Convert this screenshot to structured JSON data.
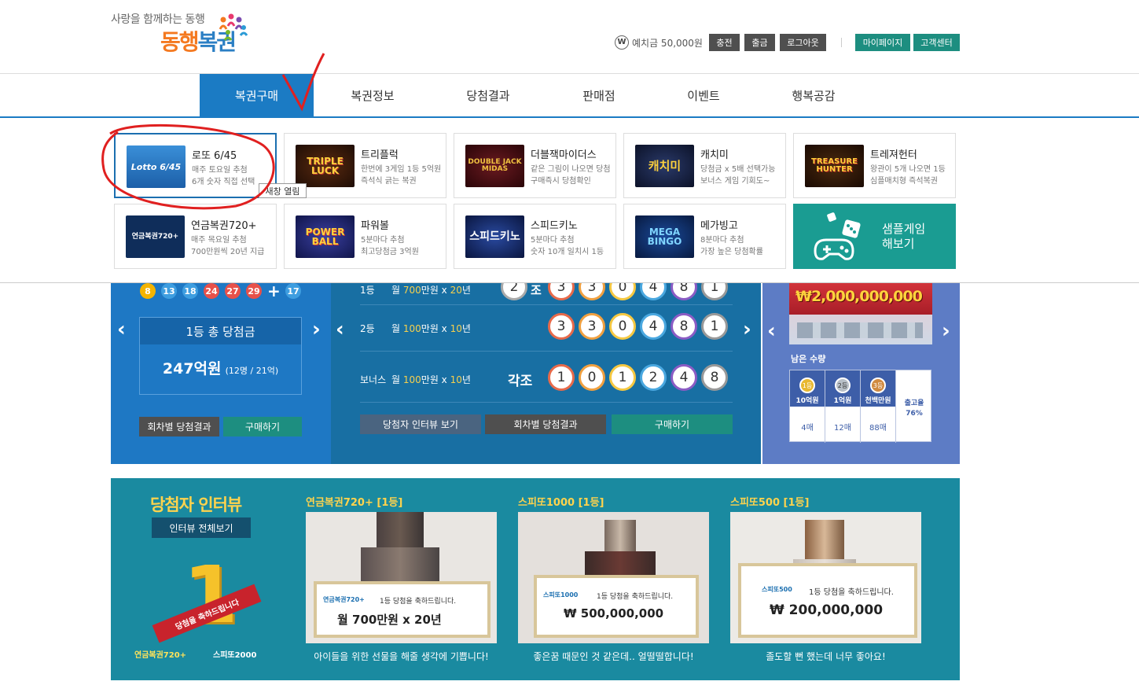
{
  "header": {
    "tagline": "사랑을 함께하는 동행",
    "logo_part1": "동행",
    "logo_part2": "복권",
    "currency_icon": "W",
    "deposit_label": "예치금 50,000원",
    "charge": "충전",
    "withdraw": "출금",
    "logout": "로그아웃",
    "mypage": "마이페이지",
    "support": "고객센터"
  },
  "nav": [
    {
      "label": "복권구매"
    },
    {
      "label": "복권정보"
    },
    {
      "label": "당첨결과"
    },
    {
      "label": "판매점"
    },
    {
      "label": "이벤트"
    },
    {
      "label": "행복공감"
    }
  ],
  "games": [
    {
      "title": "로또 6/45",
      "desc1": "매주 토요일 추첨",
      "desc2": "6개 숫자 직접 선택",
      "thumb": "Lotto 6/45"
    },
    {
      "title": "트리플럭",
      "desc1": "한번에 3게임 1등 5억원",
      "desc2": "즉석식 긁는 복권",
      "thumb": "TRIPLE LUCK"
    },
    {
      "title": "더블잭마이더스",
      "desc1": "같은 그림이 나오면 당첨",
      "desc2": "구매즉시 당첨확인",
      "thumb": "DOUBLE JACK MIDAS"
    },
    {
      "title": "캐치미",
      "desc1": "당첨금 x 5배 선택가능",
      "desc2": "보너스 게임 기회도~",
      "thumb": "캐치미"
    },
    {
      "title": "트레져헌터",
      "desc1": "왕관이 5개 나오면 1등",
      "desc2": "심플매치형 즉석복권",
      "thumb": "TREASURE HUNTER"
    },
    {
      "title": "연금복권720+",
      "desc1": "매주 목요일 추첨",
      "desc2": "700만원씩 20년 지급",
      "thumb": "연금복권720+"
    },
    {
      "title": "파워볼",
      "desc1": "5분마다 추첨",
      "desc2": "최고당첨금 3억원",
      "thumb": "POWER BALL"
    },
    {
      "title": "스피드키노",
      "desc1": "5분마다 추첨",
      "desc2": "숫자 10개 일치시 1등",
      "thumb": "스피드키노"
    },
    {
      "title": "메가빙고",
      "desc1": "8분마다 추첨",
      "desc2": "가장 높은 당첨확률",
      "thumb": "MEGA BINGO"
    }
  ],
  "sample_game": {
    "line1": "샘플게임",
    "line2": "해보기"
  },
  "tooltip": "새창 열림",
  "lotto_panel": {
    "balls": [
      "8",
      "13",
      "18",
      "24",
      "27",
      "29"
    ],
    "plus": "+",
    "bonus": "17",
    "prize_title": "1등 총 당첨금",
    "prize_amount": "247억원",
    "prize_detail": "(12명 / 21억)",
    "btn_results": "회차별 당첨결과",
    "btn_buy": "구매하기"
  },
  "pension_panel": {
    "row1_rank": "1등",
    "row1_prize_a": "월",
    "row1_prize_b": "700",
    "row1_prize_c": "만원 x",
    "row1_prize_d": "20",
    "row1_prize_e": "년",
    "row1_group": "2",
    "row1_jo": "조",
    "row1_digits": [
      "3",
      "3",
      "0",
      "4",
      "8",
      "1"
    ],
    "row2_rank": "2등",
    "row2_prize_a": "월",
    "row2_prize_b": "100",
    "row2_prize_c": "만원 x",
    "row2_prize_d": "10",
    "row2_prize_e": "년",
    "row2_digits": [
      "3",
      "3",
      "0",
      "4",
      "8",
      "1"
    ],
    "row3_rank": "보너스",
    "row3_prize_a": "월",
    "row3_prize_b": "100",
    "row3_prize_c": "만원 x",
    "row3_prize_d": "10",
    "row3_prize_e": "년",
    "row3_group": "각조",
    "row3_digits": [
      "1",
      "0",
      "1",
      "2",
      "4",
      "8"
    ],
    "btn_interview": "당첨자 인터뷰 보기",
    "btn_results": "회차별 당첨결과",
    "btn_buy": "구매하기"
  },
  "speetto_panel": {
    "banner": "₩2,000,000,000",
    "remaining": "남은 수량",
    "medals": [
      "1등",
      "2등",
      "3등"
    ],
    "cols": [
      "10억원",
      "1억원",
      "천백만원"
    ],
    "counts": [
      "4매",
      "12매",
      "88매"
    ],
    "release_label": "출고율",
    "release_rate": "76%"
  },
  "interview": {
    "title": "당첨자 인터뷰",
    "view_all": "인터뷰 전체보기",
    "promo_big": "1",
    "promo_ribbon": "당첨을 축하드립니다",
    "promo_logo1": "연금복권720+",
    "promo_logo2": "스피또2000",
    "cards": [
      {
        "title": "연금복권720+ [1등]",
        "board_logo": "연금복권720+",
        "board_msg": "1등 당첨을 축하드립니다.",
        "board_amount": "월 700만원 x 20년",
        "caption": "아이들을 위한 선물을 해줄 생각에 기쁩니다!"
      },
      {
        "title": "스피또1000 [1등]",
        "board_logo": "스피또1000",
        "board_msg": "1등 당첨을 축하드립니다.",
        "board_amount": "₩ 500,000,000",
        "caption": "좋은꿈 때문인 것 같은데.. 얼떨떨합니다!"
      },
      {
        "title": "스피또500 [1등]",
        "board_logo": "스피또500",
        "board_msg": "1등 당첨을 축하드립니다.",
        "board_amount": "₩ 200,000,000",
        "caption": "졸도할 뻔 했는데 너무 좋아요!"
      }
    ]
  },
  "colors": {
    "primary": "#1b7bc4",
    "teal": "#1d8e80",
    "dark_btn": "#4f4f4f",
    "annotation": "#e02020"
  }
}
